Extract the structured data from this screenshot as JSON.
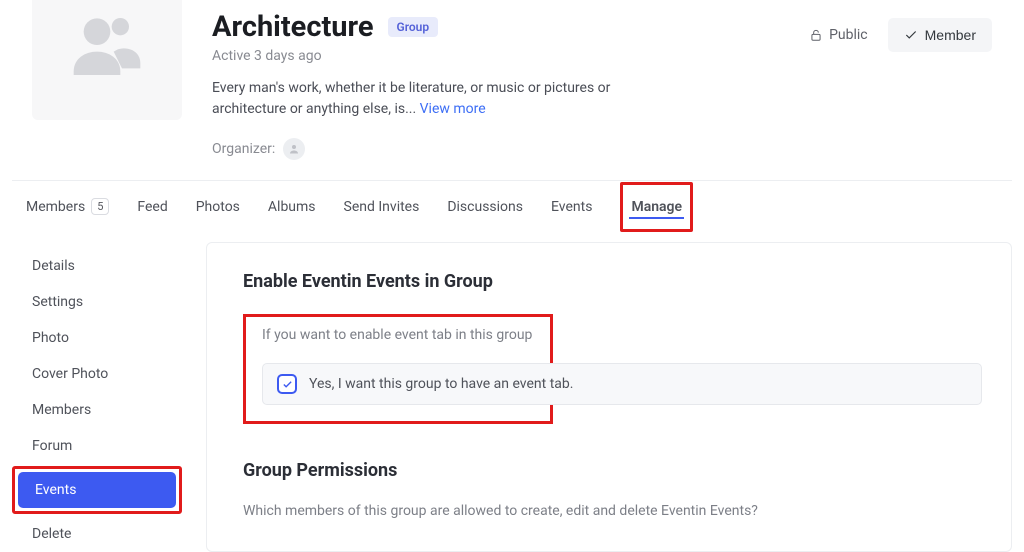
{
  "header": {
    "title": "Architecture",
    "badge": "Group",
    "activity": "Active 3 days ago",
    "description": "Every man's work, whether it be literature, or music or pictures or architecture or anything else, is... ",
    "view_more": "View more",
    "organizer_label": "Organizer:",
    "privacy": "Public",
    "member_btn": "Member"
  },
  "tabs": {
    "members": "Members",
    "members_count": "5",
    "feed": "Feed",
    "photos": "Photos",
    "albums": "Albums",
    "send_invites": "Send Invites",
    "discussions": "Discussions",
    "events": "Events",
    "manage": "Manage"
  },
  "sidebar": {
    "details": "Details",
    "settings": "Settings",
    "photo": "Photo",
    "cover_photo": "Cover Photo",
    "members": "Members",
    "forum": "Forum",
    "events": "Events",
    "delete": "Delete"
  },
  "content": {
    "enable_title": "Enable Eventin Events in Group",
    "enable_hint": "If you want to enable event tab in this group",
    "checkbox_label": "Yes, I want this group to have an event tab.",
    "permissions_title": "Group Permissions",
    "permissions_hint": "Which members of this group are allowed to create, edit and delete Eventin Events?"
  }
}
